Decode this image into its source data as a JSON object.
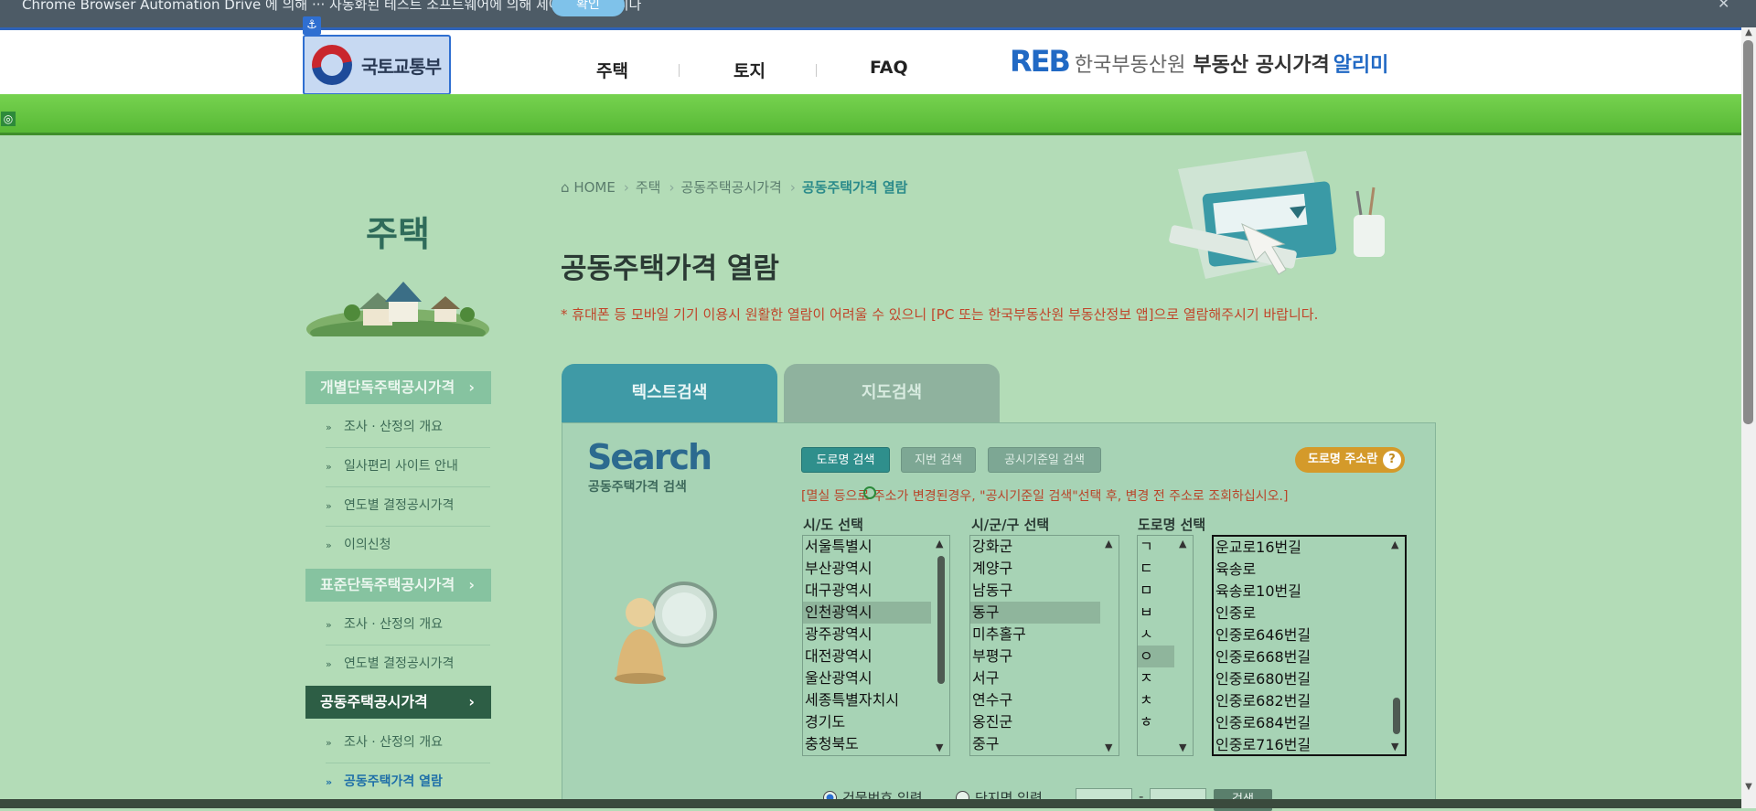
{
  "banner": {
    "text": "Chrome Browser Automation Drive 에 의해 ··· 자동화된 테스트 소프트웨어에 의해 제어되고 있습니다",
    "button": "확인"
  },
  "header": {
    "logo_text": "국토교통부",
    "nav": [
      "주택",
      "토지",
      "FAQ"
    ],
    "reb": {
      "mark": "REB",
      "name": "한국부동산원",
      "sub": "부동산 공시가격",
      "accent": "알리미"
    }
  },
  "sidebar": {
    "title": "주택",
    "groups": [
      {
        "label": "개별단독주택공시가격",
        "items": [
          "조사 · 산정의 개요",
          "일사편리 사이트 안내",
          "연도별 결정공시가격",
          "이의신청"
        ]
      },
      {
        "label": "표준단독주택공시가격",
        "items": [
          "조사 · 산정의 개요",
          "연도별 결정공시가격"
        ]
      },
      {
        "label": "공동주택공시가격",
        "items": [
          "조사 · 산정의 개요",
          "공동주택가격 열람"
        ]
      }
    ]
  },
  "breadcrumb": [
    "HOME",
    "주택",
    "공동주택공시가격",
    "공동주택가격 열람"
  ],
  "page_title": "공동주택가격 열람",
  "notice": "* 휴대폰 등 모바일 기기 이용시 원활한 열람이 어려울 수 있으니 [PC 또는 한국부동산원 부동산정보 앱]으로 열람해주시기 바랍니다.",
  "tabs": [
    "텍스트검색",
    "지도검색"
  ],
  "search": {
    "logo": "Search",
    "logo_sub": "공동주택가격 검색",
    "modes": [
      "도로명 검색",
      "지번 검색",
      "공시기준일 검색"
    ],
    "road_help": "도로명 주소란",
    "hint": "[멸실 등으로 주소가 변경된경우, \"공시기준일 검색\"선택 후, 변경 전 주소로 조회하십시오.]",
    "labels": {
      "sido": "시/도 선택",
      "sigungu": "시/군/구 선택",
      "road": "도로명 선택"
    },
    "sido": [
      "서울특별시",
      "부산광역시",
      "대구광역시",
      "인천광역시",
      "광주광역시",
      "대전광역시",
      "울산광역시",
      "세종특별자치시",
      "경기도",
      "충청북도"
    ],
    "sido_selected": "인천광역시",
    "sigungu": [
      "강화군",
      "계양구",
      "남동구",
      "동구",
      "미추홀구",
      "부평구",
      "서구",
      "연수구",
      "옹진군",
      "중구"
    ],
    "sigungu_selected": "동구",
    "initials": [
      "ㄱ",
      "ㄷ",
      "ㅁ",
      "ㅂ",
      "ㅅ",
      "ㅇ",
      "ㅈ",
      "ㅊ",
      "ㅎ"
    ],
    "initial_selected": "ㅇ",
    "roads": [
      "운교로16번길",
      "육송로",
      "육송로10번길",
      "인중로",
      "인중로646번길",
      "인중로668번길",
      "인중로680번길",
      "인중로682번길",
      "인중로684번길",
      "인중로716번길"
    ],
    "radio1": "건물번호 입력",
    "radio2": "단지명 입력",
    "dash": "-",
    "go": "검색"
  },
  "colors": {
    "accent": "#3f9aa6",
    "green_bar": "#58b936",
    "page_bg": "#b3dcb7",
    "notice": "#c0452a"
  }
}
